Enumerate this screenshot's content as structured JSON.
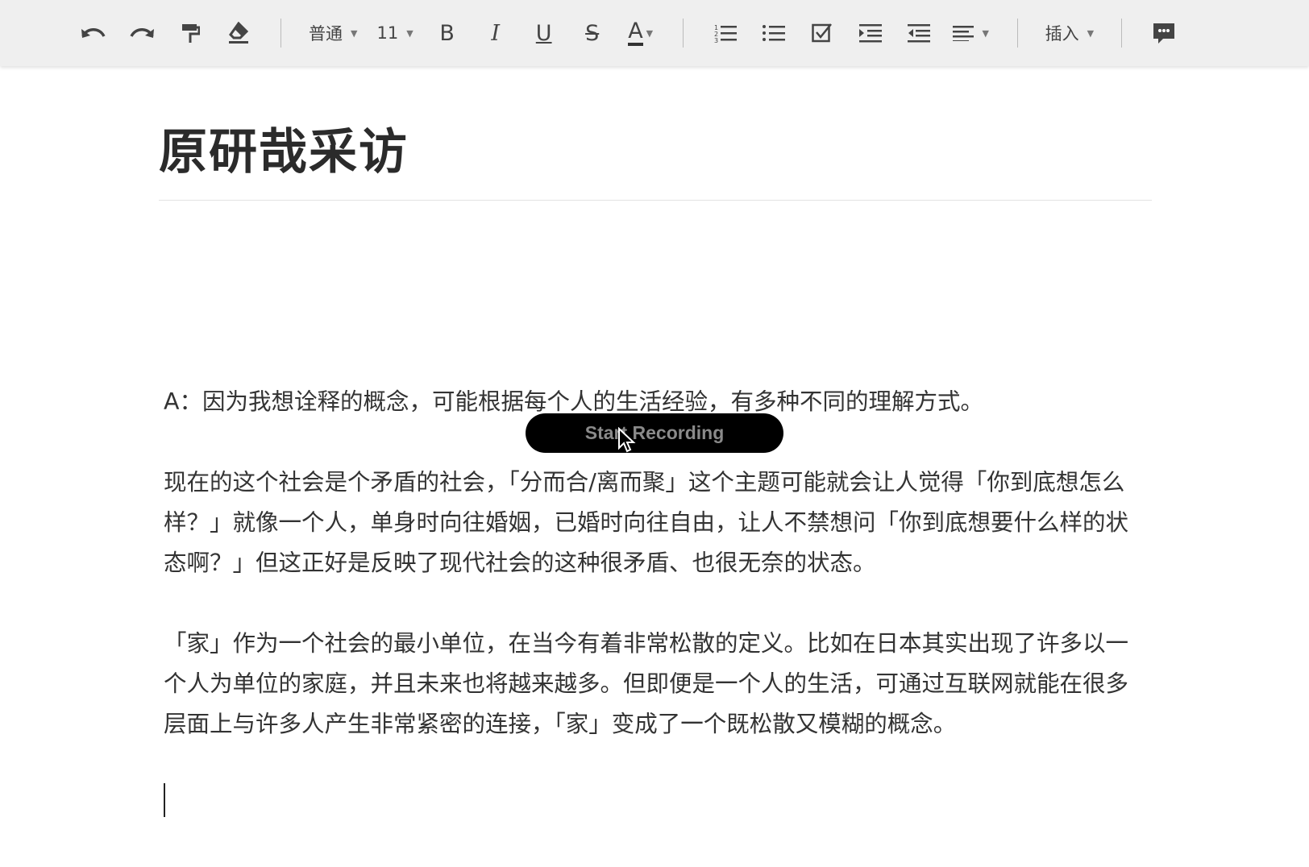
{
  "toolbar": {
    "style_label": "普通",
    "font_size": "11",
    "insert_label": "插入",
    "icons": [
      "undo-icon",
      "redo-icon",
      "format-painter-icon",
      "eraser-icon",
      "bold-icon",
      "italic-icon",
      "underline-icon",
      "strikethrough-icon",
      "text-color-icon",
      "ordered-list-icon",
      "bullet-list-icon",
      "checklist-icon",
      "indent-icon",
      "outdent-icon",
      "align-icon",
      "comment-icon"
    ],
    "glyphs": {
      "bold": "B",
      "italic": "I",
      "underline": "U",
      "strike": "S",
      "color": "A"
    }
  },
  "document": {
    "title": "原研哉采访",
    "paragraphs": [
      "A：因为我想诠释的概念，可能根据每个人的生活经验，有多种不同的理解方式。",
      "现在的这个社会是个矛盾的社会，「分而合/离而聚」这个主题可能就会让人觉得「你到底想怎么样？」就像一个人，单身时向往婚姻，已婚时向往自由，让人不禁想问「你到底想要什么样的状态啊？」但这正好是反映了现代社会的这种很矛盾、也很无奈的状态。",
      "「家」作为一个社会的最小单位，在当今有着非常松散的定义。比如在日本其实出现了许多以一个人为单位的家庭，并且未来也将越来越多。但即便是一个人的生活，可通过互联网就能在很多层面上与许多人产生非常紧密的连接，「家」变成了一个既松散又模糊的概念。"
    ]
  },
  "overlay": {
    "recording_label": "Start Recording"
  }
}
